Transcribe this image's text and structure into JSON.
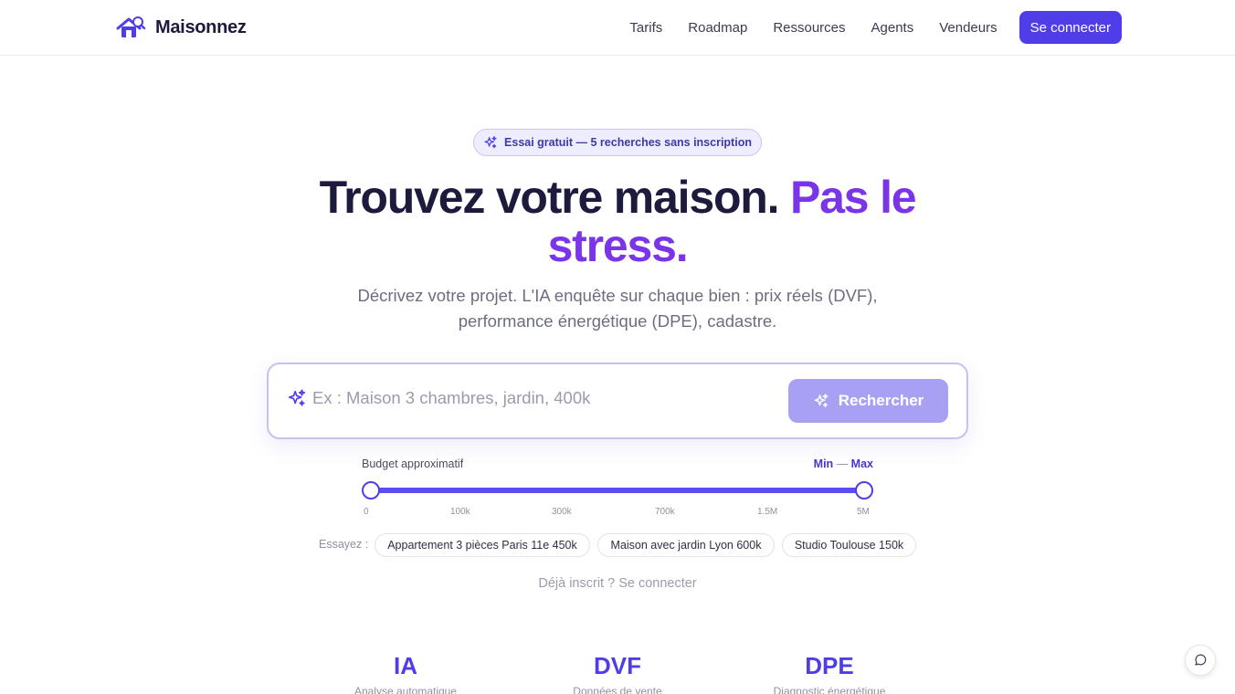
{
  "brand": {
    "name": "Maisonnez"
  },
  "nav": {
    "links": [
      "Tarifs",
      "Roadmap",
      "Ressources",
      "Agents",
      "Vendeurs"
    ],
    "cta": "Se connecter"
  },
  "hero": {
    "badge": "Essai gratuit — 5 recherches sans inscription",
    "title_main": "Trouvez votre maison.",
    "title_accent": "Pas le stress.",
    "subtitle": "Décrivez votre projet. L'IA enquête sur chaque bien : prix réels (DVF), performance énergétique (DPE), cadastre."
  },
  "search": {
    "placeholder": "Ex : Maison 3 chambres, jardin, 400k",
    "value": "",
    "button": "Rechercher"
  },
  "budget": {
    "label": "Budget approximatif",
    "min_label": "Min",
    "separator": "—",
    "max_label": "Max",
    "ticks": [
      "0",
      "100k",
      "300k",
      "700k",
      "1.5M",
      "5M"
    ],
    "selected_min": "0",
    "selected_max": "5M"
  },
  "examples": {
    "label": "Essayez :",
    "chips": [
      "Appartement 3 pièces Paris 11e 450k",
      "Maison avec jardin Lyon 600k",
      "Studio Toulouse 150k"
    ]
  },
  "login_prompt": "Déjà inscrit ? Se connecter",
  "stats": [
    {
      "value": "IA",
      "label": "Analyse automatique"
    },
    {
      "value": "DVF",
      "label": "Données de vente"
    },
    {
      "value": "DPE",
      "label": "Diagnostic énergétique"
    }
  ],
  "colors": {
    "primary": "#4f3ee8",
    "accent": "#7b35e8",
    "text_dark": "#1c1a3d",
    "muted": "#6b6e80",
    "button_disabled": "#a8a1f3"
  },
  "icons": {
    "logo": "house-search-icon",
    "badge": "sparkles-icon",
    "search": "sparkles-icon",
    "button": "sparkles-icon",
    "chat": "chat-bubble-icon"
  }
}
